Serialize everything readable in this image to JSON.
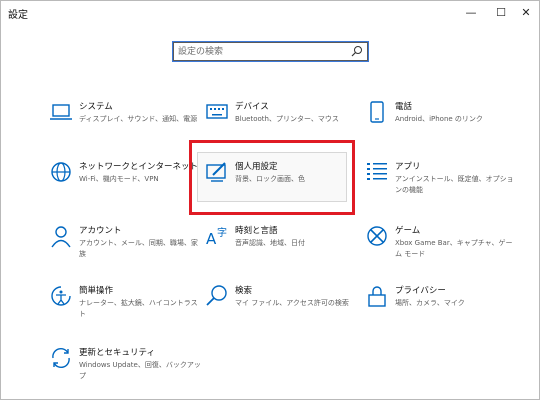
{
  "window": {
    "title": "設定",
    "minimize_glyph": "—",
    "maximize_glyph": "☐",
    "close_glyph": "✕"
  },
  "search": {
    "placeholder": "設定の検索",
    "value": "",
    "icon": "search-icon"
  },
  "accent_color": "#0067c0",
  "highlight_color": "#e01b24",
  "tiles": [
    {
      "name": "システム",
      "desc": "ディスプレイ、サウンド、通知、電源",
      "icon": "laptop-icon"
    },
    {
      "name": "デバイス",
      "desc": "Bluetooth、プリンター、マウス",
      "icon": "keyboard-icon"
    },
    {
      "name": "電話",
      "desc": "Android、iPhone のリンク",
      "icon": "phone-icon"
    },
    {
      "name": "ネットワークとインターネット",
      "desc": "Wi-Fi、機内モード、VPN",
      "icon": "globe-icon"
    },
    {
      "name": "個人用設定",
      "desc": "背景、ロック画面、色",
      "icon": "personalization-icon"
    },
    {
      "name": "アプリ",
      "desc": "アンインストール、既定値、オプションの機能",
      "icon": "apps-list-icon"
    },
    {
      "name": "アカウント",
      "desc": "アカウント、メール、同期、職場、家族",
      "icon": "person-icon"
    },
    {
      "name": "時刻と言語",
      "desc": "音声認識、地域、日付",
      "icon": "time-language-icon"
    },
    {
      "name": "ゲーム",
      "desc": "Xbox Game Bar、キャプチャ、ゲーム モード",
      "icon": "xbox-icon"
    },
    {
      "name": "簡単操作",
      "desc": "ナレーター、拡大鏡、ハイコントラスト",
      "icon": "ease-of-access-icon"
    },
    {
      "name": "検索",
      "desc": "マイ ファイル、アクセス許可の検索",
      "icon": "magnifier-icon"
    },
    {
      "name": "プライバシー",
      "desc": "場所、カメラ、マイク",
      "icon": "lock-icon"
    },
    {
      "name": "更新とセキュリティ",
      "desc": "Windows Update、回復、バックアップ",
      "icon": "update-icon"
    }
  ]
}
